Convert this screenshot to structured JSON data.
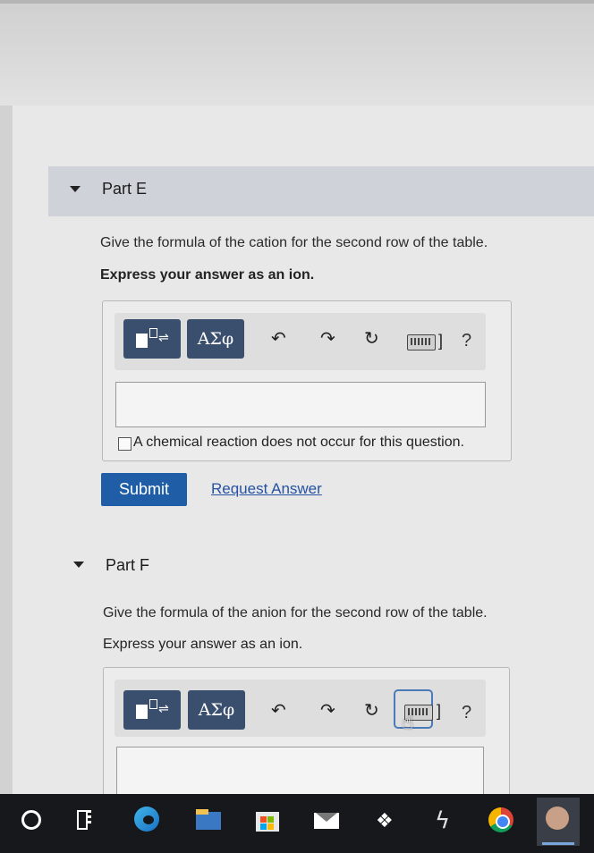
{
  "colors": {
    "submit": "#1f5ea6",
    "link": "#2552a3",
    "tool_button": "#3a4f6e",
    "header": "#cfd3d9"
  },
  "part_e": {
    "title": "Part E",
    "prompt": "Give the formula of the cation for the second row of the table.",
    "instruction": "Express your answer as an ion.",
    "toolbar": {
      "template_icon": "template-icon",
      "greek_label": "ΑΣφ",
      "undo_icon": "undo-icon",
      "redo_icon": "redo-icon",
      "reset_icon": "reset-icon",
      "keyboard_icon": "keyboard-icon",
      "help_label": "?"
    },
    "answer_value": "",
    "no_reaction_label": "A chemical reaction does not occur for this question.",
    "submit_label": "Submit",
    "request_answer_label": "Request Answer"
  },
  "part_f": {
    "title": "Part F",
    "prompt": "Give the formula of the anion for the second row of the table.",
    "instruction": "Express your answer as an ion.",
    "toolbar": {
      "greek_label": "ΑΣφ",
      "help_label": "?"
    },
    "answer_value": ""
  },
  "taskbar": {
    "icons": [
      "search-circle-icon",
      "task-view-icon",
      "edge-icon",
      "file-explorer-icon",
      "store-icon",
      "mail-icon",
      "dropbox-icon",
      "app-icon",
      "chrome-icon",
      "avatar-app-icon"
    ]
  }
}
